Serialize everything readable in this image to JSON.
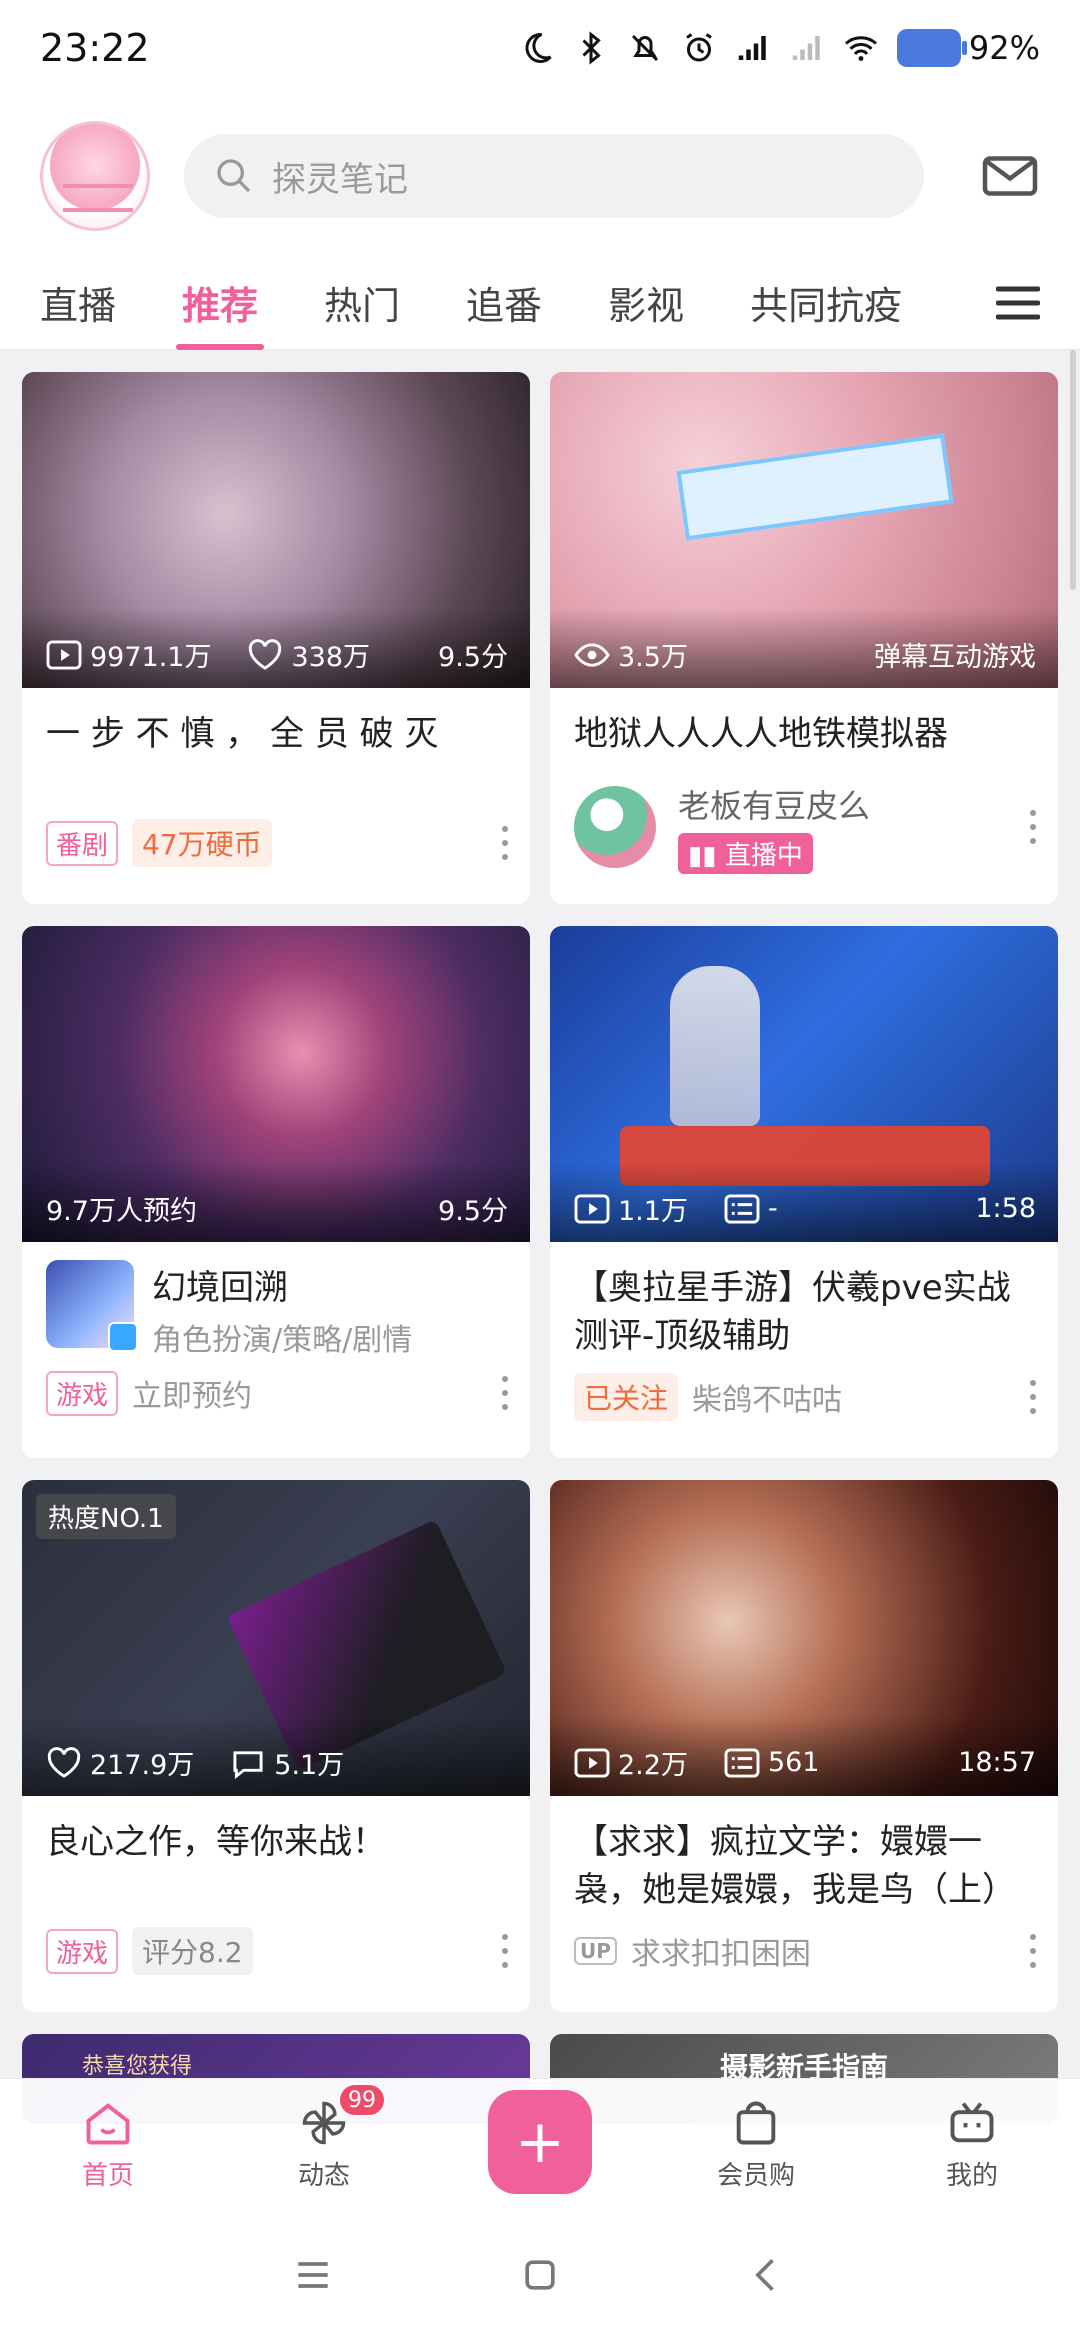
{
  "status_bar": {
    "time": "23:22",
    "battery": "92%"
  },
  "search": {
    "placeholder": "探灵笔记"
  },
  "tabs": [
    {
      "label": "直播"
    },
    {
      "label": "推荐"
    },
    {
      "label": "热门"
    },
    {
      "label": "追番"
    },
    {
      "label": "影视"
    },
    {
      "label": "共同抗疫"
    }
  ],
  "active_tab": "推荐",
  "cards": [
    {
      "stat1": "9971.1万",
      "stat2": "338万",
      "right": "9.5分",
      "title": "一 步 不 慎 ， 全 员 破 灭",
      "tag": "番剧",
      "extra": "47万硬币"
    },
    {
      "stat1": "3.5万",
      "right": "弹幕互动游戏",
      "title": "地狱人人人人地铁模拟器",
      "user": "老板有豆皮么",
      "live": "直播中"
    },
    {
      "stat1": "9.7万人预约",
      "right": "9.5分",
      "game_title": "幻境回溯",
      "game_sub": "角色扮演/策略/剧情",
      "tag": "游戏",
      "extra": "立即预约"
    },
    {
      "stat1": "1.1万",
      "stat2": "-",
      "right": "1:58",
      "title": "【奥拉星手游】伏羲pve实战测评-顶级辅助",
      "followed": "已关注",
      "author": "柴鸽不咕咕"
    },
    {
      "hot": "热度NO.1",
      "stat1": "217.9万",
      "stat2": "5.1万",
      "title": "良心之作，等你来战！",
      "tag": "游戏",
      "extra": "评分8.2"
    },
    {
      "stat1": "2.2万",
      "stat2": "561",
      "right": "18:57",
      "title": "【求求】疯拉文学：嬛嬛一袅，她是嬛嬛，我是鸟（上）",
      "up": "UP",
      "author": "求求扣扣困困"
    }
  ],
  "partial_cards": [
    {
      "text": "恭喜您获得"
    },
    {
      "text": "摄影新手指南"
    }
  ],
  "bottom_nav": [
    {
      "label": "首页"
    },
    {
      "label": "动态",
      "badge": "99"
    },
    {
      "label": "+"
    },
    {
      "label": "会员购"
    },
    {
      "label": "我的"
    }
  ],
  "colors": {
    "accent": "#f0609a",
    "coin": "#f06a3b"
  }
}
